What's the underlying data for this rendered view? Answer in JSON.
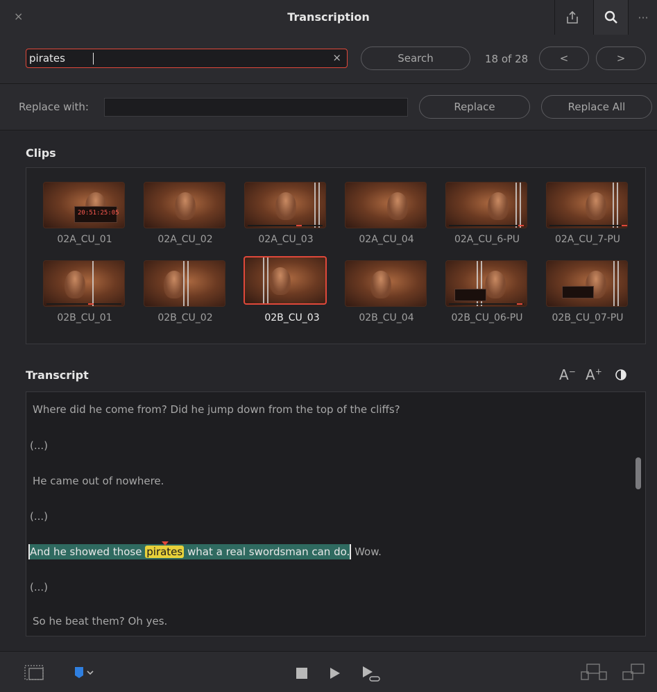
{
  "window": {
    "title": "Transcription",
    "close_label": "×",
    "more_label": "···"
  },
  "search": {
    "value": "pirates",
    "clear_label": "×",
    "button_label": "Search",
    "result_count": "18 of 28",
    "prev_label": "<",
    "next_label": ">"
  },
  "replace": {
    "label": "Replace with:",
    "value": "",
    "replace_label": "Replace",
    "replace_all_label": "Replace All"
  },
  "clips": {
    "title": "Clips",
    "selected": "02B_CU_03",
    "items": [
      {
        "name": "02A_CU_01",
        "slate": "20:51:25:05"
      },
      {
        "name": "02A_CU_02"
      },
      {
        "name": "02A_CU_03"
      },
      {
        "name": "02A_CU_04"
      },
      {
        "name": "02A_CU_6-PU"
      },
      {
        "name": "02A_CU_7-PU"
      },
      {
        "name": "02B_CU_01"
      },
      {
        "name": "02B_CU_02"
      },
      {
        "name": "02B_CU_03"
      },
      {
        "name": "02B_CU_04"
      },
      {
        "name": "02B_CU_06-PU"
      },
      {
        "name": "02B_CU_07-PU"
      }
    ]
  },
  "transcript": {
    "title": "Transcript",
    "font_decrease_label": "A",
    "font_increase_label": "A",
    "lines": [
      "Where did he come from? Did he jump down from the top of the cliffs?",
      "(...)",
      "He came out of nowhere.",
      "(...)",
      "",
      "(...)",
      "So he beat them? Oh yes."
    ],
    "highlighted_line": {
      "before": "And he showed those",
      "match": "pirates",
      "after": "what a real swordsman can do.",
      "trailing": "Wow."
    }
  },
  "colors": {
    "accent_red": "#e0483a",
    "highlight_teal": "#2f6a60",
    "match_yellow": "#e8d13a",
    "flag_blue": "#2f7fe0"
  },
  "icons": {
    "titlebar": [
      "close-icon",
      "export-icon",
      "search-icon",
      "more-icon"
    ],
    "bottombar": [
      "timeline-icon",
      "flag-icon",
      "stop-icon",
      "play-icon",
      "play-to-end-icon",
      "insert-clip-icon",
      "append-clip-icon"
    ]
  }
}
